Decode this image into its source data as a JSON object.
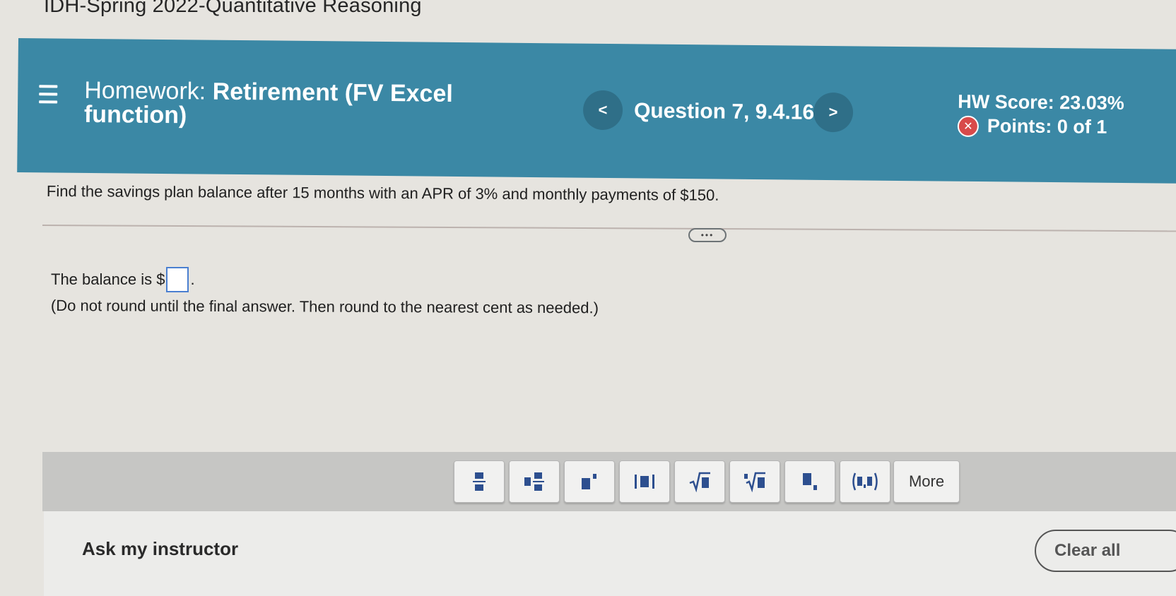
{
  "course": {
    "title": "IDH-Spring 2022-Quantitative Reasoning"
  },
  "header": {
    "homework_prefix": "Homework:",
    "homework_name": "Retirement (FV Excel function)",
    "question_label": "Question 7, 9.4.16",
    "prev_symbol": "<",
    "next_symbol": ">",
    "hw_score": "HW Score: 23.03%",
    "points": "Points: 0 of 1",
    "points_status_icon": "x-circle-icon"
  },
  "question": {
    "text": "Find the savings plan balance after 15 months with an APR of 3% and monthly payments of $150.",
    "expand_label": "•••"
  },
  "answer": {
    "prefix": "The balance is $",
    "value": "",
    "suffix": ".",
    "hint": "(Do not round until the final answer. Then round to the nearest cent as needed.)"
  },
  "math_toolbar": {
    "tools": [
      "fraction-icon",
      "mixed-number-icon",
      "exponent-icon",
      "absolute-value-icon",
      "square-root-icon",
      "nth-root-icon",
      "subscript-icon",
      "ordered-pair-icon"
    ],
    "more_label": "More"
  },
  "footer": {
    "ask_instructor": "Ask my instructor",
    "clear_all": "Clear all"
  },
  "colors": {
    "banner": "#3b88a5",
    "nav_button": "#2f6f88",
    "answer_box_border": "#4a7fd0",
    "error": "#d84a4a"
  }
}
